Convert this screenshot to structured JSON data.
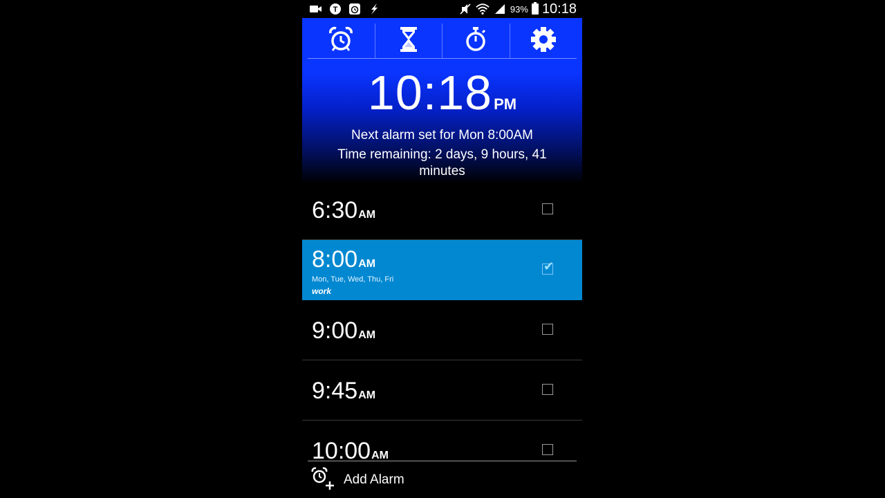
{
  "status_bar": {
    "left_icons": [
      "record-icon",
      "t-badge-icon",
      "alarm-clock-icon",
      "flash-icon"
    ],
    "right_icons": [
      "mute-icon",
      "wifi-icon",
      "signal-icon",
      "battery-icon"
    ],
    "battery": "93%",
    "clock": "10:18"
  },
  "toolbar": {
    "tabs": [
      {
        "icon": "alarm-clock-icon"
      },
      {
        "icon": "hourglass-icon"
      },
      {
        "icon": "stopwatch-icon"
      },
      {
        "icon": "gear-icon"
      }
    ]
  },
  "clock": {
    "time": "10:18",
    "ampm": "PM"
  },
  "next_alarm": "Next alarm set for Mon 8:00AM",
  "time_remaining": "Time remaining: 2 days, 9 hours, 41 minutes",
  "alarms": [
    {
      "time": "6:30",
      "ampm": "AM",
      "days": "",
      "label": "",
      "checked": false
    },
    {
      "time": "8:00",
      "ampm": "AM",
      "days": "Mon, Tue, Wed, Thu, Fri",
      "label": "work",
      "checked": true
    },
    {
      "time": "9:00",
      "ampm": "AM",
      "days": "",
      "label": "",
      "checked": false
    },
    {
      "time": "9:45",
      "ampm": "AM",
      "days": "",
      "label": "",
      "checked": false
    },
    {
      "time": "10:00",
      "ampm": "AM",
      "days": "",
      "label": "",
      "checked": false
    }
  ],
  "footer": {
    "add_label": "Add Alarm",
    "add_icon": "add-alarm-icon"
  },
  "colors": {
    "header_blue": "#0a35ff",
    "selected_row": "#0288d1"
  }
}
